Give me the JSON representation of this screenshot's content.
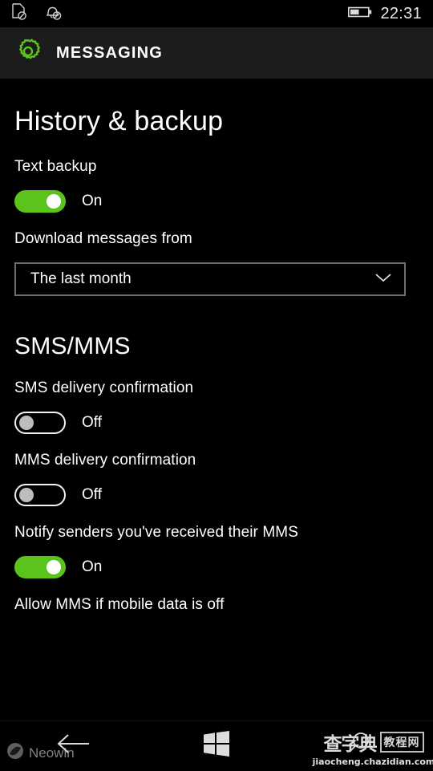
{
  "statusbar": {
    "time": "22:31",
    "icons": [
      {
        "name": "sim-disabled-icon"
      },
      {
        "name": "notifications-off-icon"
      }
    ],
    "battery": {
      "name": "battery-icon",
      "level_percent": 50
    }
  },
  "header": {
    "icon": "settings-gear-icon",
    "title": "MESSAGING",
    "accent_color": "#5ac41c",
    "background": "#1c1c1c"
  },
  "page": {
    "title": "History & backup"
  },
  "history_backup": {
    "text_backup": {
      "label": "Text backup",
      "state": "On",
      "checked": true
    },
    "download_messages": {
      "label": "Download messages from",
      "value": "The last month",
      "chevron": "chevron-down-icon"
    }
  },
  "sms_mms": {
    "title": "SMS/MMS",
    "items": [
      {
        "label": "SMS delivery confirmation",
        "state": "Off",
        "checked": false
      },
      {
        "label": "MMS delivery confirmation",
        "state": "Off",
        "checked": false
      },
      {
        "label": "Notify senders you've received their MMS",
        "state": "On",
        "checked": true
      },
      {
        "label": "Allow MMS if mobile data is off",
        "state": "",
        "checked": false
      }
    ]
  },
  "navbar": {
    "back": "back-arrow-icon",
    "start": "windows-start-icon",
    "search": "search-icon"
  },
  "watermarks": {
    "neowin": {
      "logo": "neowin-logo-icon",
      "text": "Neowin"
    },
    "chazidian": {
      "title": "查字典",
      "badge": "教程网",
      "url": "jiaocheng.chazidian.com"
    }
  }
}
